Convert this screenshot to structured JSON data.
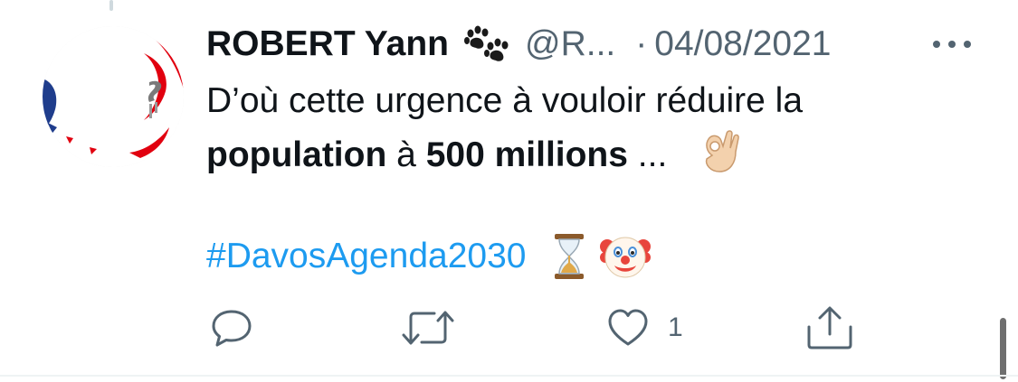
{
  "tweet": {
    "display_name": "ROBERT Yann",
    "name_emoji": "paw-prints-emoji",
    "handle": "@R...",
    "separator": "·",
    "date": "04/08/2021",
    "more_icon": "more-horizontal-icon",
    "text": {
      "line1": "D’où cette urgence à vouloir réduire la",
      "bold1": "population",
      "mid": "à",
      "bold2": "500 millions",
      "ellipsis": "...",
      "emoji": "ok-hand-emoji"
    },
    "hashtag": "#DavosAgenda2030",
    "trailing_emojis": [
      "hourglass-done-emoji",
      "clown-face-emoji"
    ]
  },
  "actions": {
    "reply_icon": "reply-icon",
    "retweet_icon": "retweet-icon",
    "like_icon": "heart-icon",
    "like_count": "1",
    "share_icon": "share-icon"
  },
  "colors": {
    "text": "#0f1419",
    "secondary": "#536471",
    "link": "#1d9bf0",
    "french_blue": "#1f3d8c",
    "french_red": "#e1000f"
  }
}
